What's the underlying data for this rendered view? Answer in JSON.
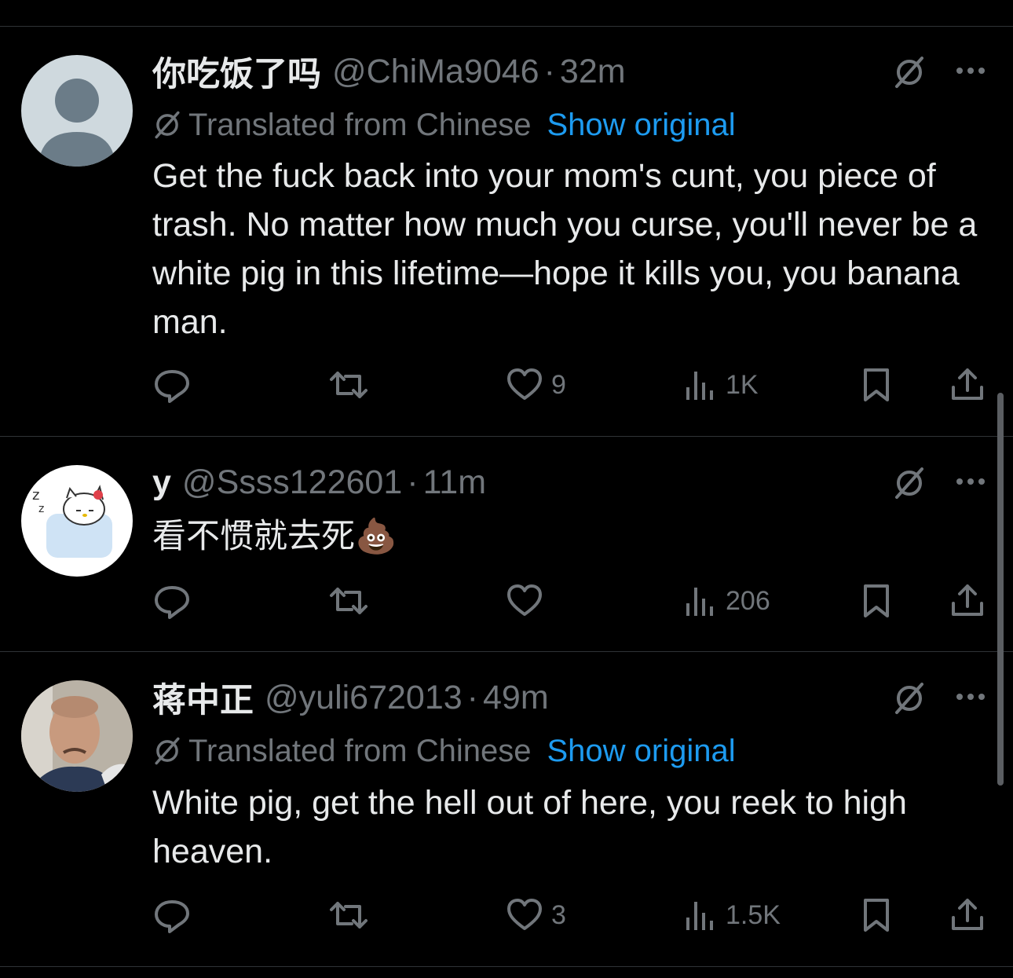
{
  "tweets": [
    {
      "name": "你吃饭了吗",
      "handle": "@ChiMa9046",
      "separator": "·",
      "time": "32m",
      "translated_label": "Translated from Chinese",
      "show_original": "Show original",
      "text": "Get the fuck back into your mom's cunt, you piece of trash. No matter how much you curse, you'll never be a white pig in this lifetime—hope it kills you, you banana man.",
      "likes": "9",
      "views": "1K"
    },
    {
      "name": "y",
      "handle": "@Ssss122601",
      "separator": "·",
      "time": "11m",
      "text": "看不惯就去死💩",
      "likes": "",
      "views": "206"
    },
    {
      "name": "蒋中正",
      "handle": "@yuli672013",
      "separator": "·",
      "time": "49m",
      "translated_label": "Translated from Chinese",
      "show_original": "Show original",
      "text": "White pig, get the hell out of here, you reek to high heaven.",
      "likes": "3",
      "views": "1.5K"
    }
  ],
  "colors": {
    "background": "#000000",
    "text": "#e7e9ea",
    "secondary": "#71767b",
    "link": "#1d9bf0",
    "divider": "#2f3336"
  },
  "icons": [
    "reply-icon",
    "retweet-icon",
    "like-icon",
    "views-icon",
    "bookmark-icon",
    "share-icon",
    "translate-icon",
    "more-icon"
  ]
}
